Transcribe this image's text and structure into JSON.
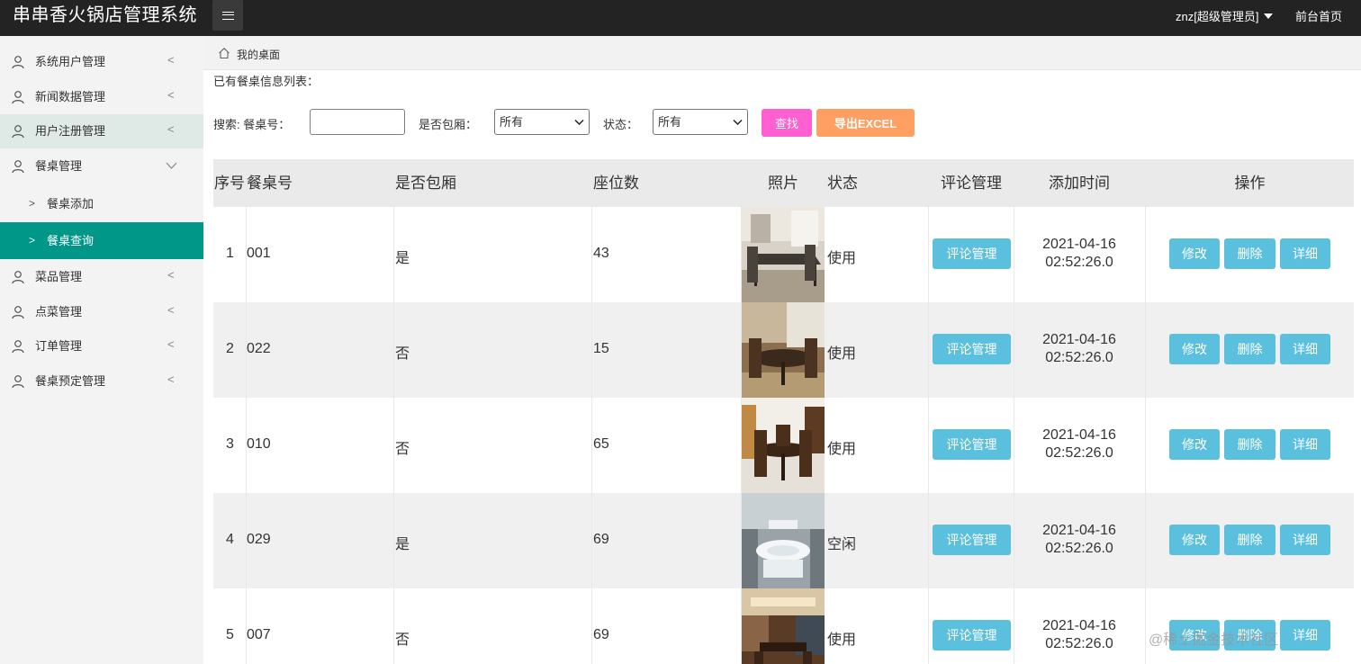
{
  "app": {
    "title": "串串香火锅店管理系统",
    "user": "znz[超级管理员]",
    "front_home": "前台首页"
  },
  "sidebar": {
    "items": [
      {
        "label": "系统用户管理"
      },
      {
        "label": "新闻数据管理"
      },
      {
        "label": "用户注册管理"
      },
      {
        "label": "餐桌管理"
      },
      {
        "label": "菜品管理"
      },
      {
        "label": "点菜管理"
      },
      {
        "label": "订单管理"
      },
      {
        "label": "餐桌预定管理"
      }
    ],
    "sub_items": [
      {
        "label": "餐桌添加"
      },
      {
        "label": "餐桌查询"
      }
    ]
  },
  "breadcrumb": {
    "label": "我的桌面"
  },
  "list_title": "已有餐桌信息列表：",
  "search": {
    "label": "搜索: 餐桌号：",
    "input_value": "",
    "private_label": "是否包厢：",
    "private_value": "所有",
    "status_label": "状态：",
    "status_value": "所有",
    "search_button": "查找",
    "export_button": "导出EXCEL"
  },
  "table": {
    "headers": [
      "序号",
      "餐桌号",
      "是否包厢",
      "座位数",
      "照片",
      "状态",
      "评论管理",
      "添加时间",
      "操作"
    ],
    "rows": [
      {
        "index": "1",
        "table_no": "001",
        "private": "是",
        "seats": "43",
        "status": "使用",
        "date": "2021-04-16",
        "time": "02:52:26.0"
      },
      {
        "index": "2",
        "table_no": "022",
        "private": "否",
        "seats": "15",
        "status": "使用",
        "date": "2021-04-16",
        "time": "02:52:26.0"
      },
      {
        "index": "3",
        "table_no": "010",
        "private": "否",
        "seats": "65",
        "status": "使用",
        "date": "2021-04-16",
        "time": "02:52:26.0"
      },
      {
        "index": "4",
        "table_no": "029",
        "private": "是",
        "seats": "69",
        "status": "空闲",
        "date": "2021-04-16",
        "time": "02:52:26.0"
      },
      {
        "index": "5",
        "table_no": "007",
        "private": "否",
        "seats": "69",
        "status": "使用",
        "date": "2021-04-16",
        "time": "02:52:26.0"
      }
    ],
    "comment_button": "评论管理",
    "edit_button": "修改",
    "delete_button": "删除",
    "detail_button": "详细"
  },
  "watermark": "@稀土掘金技术社区",
  "colors": {
    "topbar": "#232323",
    "active_menu": "#009688",
    "search_button": "#ff5fd0",
    "export_button": "#ff9f62",
    "action_button": "#5bc0de"
  }
}
